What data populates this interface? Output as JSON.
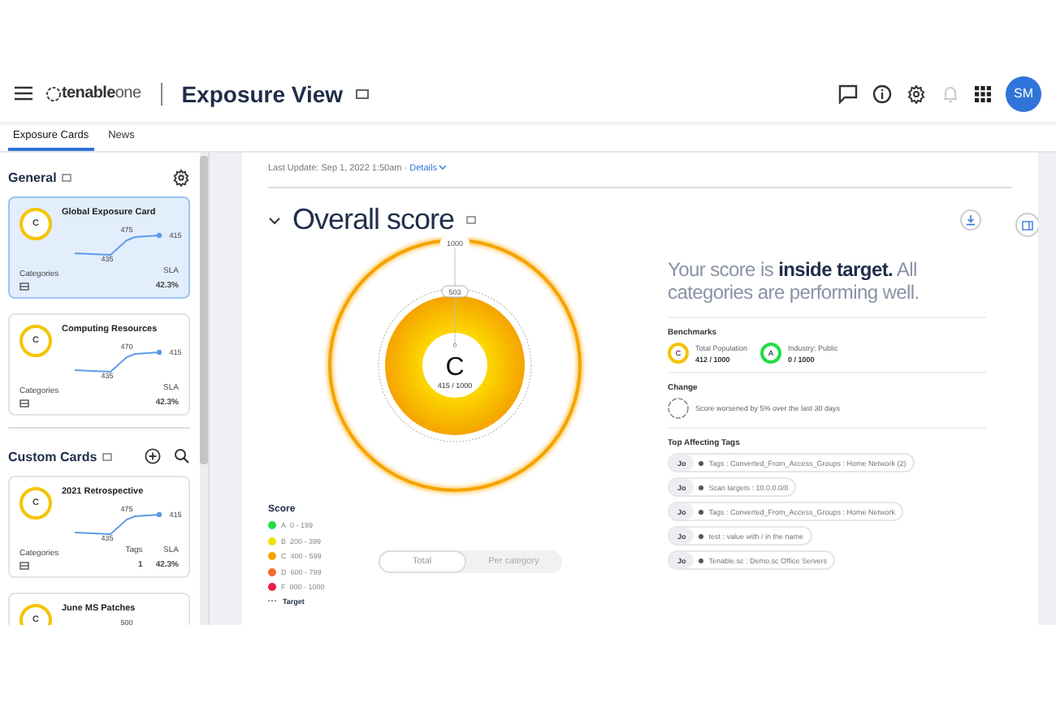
{
  "header": {
    "brand": "tenable",
    "brand_suffix": "one",
    "title": "Exposure View",
    "avatar": "SM"
  },
  "tabs": [
    {
      "label": "Exposure Cards",
      "selected": true
    },
    {
      "label": "News",
      "selected": false
    }
  ],
  "sidebar": {
    "sections": [
      {
        "title": "General",
        "kind": "settings",
        "cards": [
          {
            "title": "Global Exposure Card",
            "grade": "C",
            "selected": true,
            "labels": {
              "low": "435",
              "high": "475",
              "current": "415"
            },
            "categories": "Categories",
            "stats": [
              {
                "label": "SLA",
                "value": "42.3%"
              }
            ]
          },
          {
            "title": "Computing Resources",
            "grade": "C",
            "selected": false,
            "labels": {
              "low": "435",
              "high": "470",
              "current": "415"
            },
            "categories": "Categories",
            "stats": [
              {
                "label": "SLA",
                "value": "42.3%"
              }
            ]
          }
        ]
      },
      {
        "title": "Custom Cards",
        "kind": "search",
        "cards": [
          {
            "title": "2021 Retrospective",
            "grade": "C",
            "selected": false,
            "labels": {
              "low": "435",
              "high": "475",
              "current": "415"
            },
            "categories": "Categories",
            "stats": [
              {
                "label": "Tags",
                "value": "1"
              },
              {
                "label": "SLA",
                "value": "42.3%"
              }
            ]
          },
          {
            "title": "June MS Patches",
            "grade": "C",
            "selected": false,
            "labels": {
              "high": "500"
            }
          }
        ]
      }
    ]
  },
  "main": {
    "last_update": "Last Update: Sep 1, 2022 1:50am ·",
    "details_link": "Details",
    "section_title": "Overall score",
    "expanded": true,
    "summary": "Your score is **inside target.** All categories are performing well.",
    "ring": {
      "outer_label": "1000",
      "target_label": "503",
      "zero_label": "0",
      "grade": "C",
      "score": "415 / 1000"
    },
    "legend": {
      "title": "Score",
      "items": [
        {
          "letter": "A",
          "range": "0 - 199",
          "color": "#22dd44"
        },
        {
          "letter": "B",
          "range": "200 - 399",
          "color": "#f2e000"
        },
        {
          "letter": "C",
          "range": "400 - 599",
          "color": "#f5a300"
        },
        {
          "letter": "D",
          "range": "600 - 799",
          "color": "#f26a2e"
        },
        {
          "letter": "F",
          "range": "800 - 1000",
          "color": "#ee1a4a"
        }
      ],
      "target": "Target"
    },
    "toggle": [
      {
        "label": "Total",
        "selected": true
      },
      {
        "label": "Per category",
        "selected": false
      }
    ],
    "benchmarks": {
      "title": "Benchmarks",
      "items": [
        {
          "grade": "C",
          "label": "Total Population",
          "value": "412 / 1000",
          "color": "#f5c400"
        },
        {
          "grade": "A",
          "label": "Industry: Public",
          "value": "0 / 1000",
          "color": "#22dd44"
        }
      ]
    },
    "change": {
      "title": "Change",
      "text": "Score worsened by 5% over the last 30 days"
    },
    "tags": {
      "title": "Top Affecting Tags",
      "items": [
        {
          "badge": "Jo",
          "text": "Tags : Converted_From_Access_Groups : Home Network (2)"
        },
        {
          "badge": "Jo",
          "text": "Scan targets : 10.0.0.0/8"
        },
        {
          "badge": "Jo",
          "text": "Tags : Converted_From_Access_Groups : Home Network"
        },
        {
          "badge": "Jo",
          "text": "test : value with / in the name"
        },
        {
          "badge": "Jo",
          "text": "Tenable.sc : Demo.sc Office Servers"
        }
      ]
    }
  }
}
